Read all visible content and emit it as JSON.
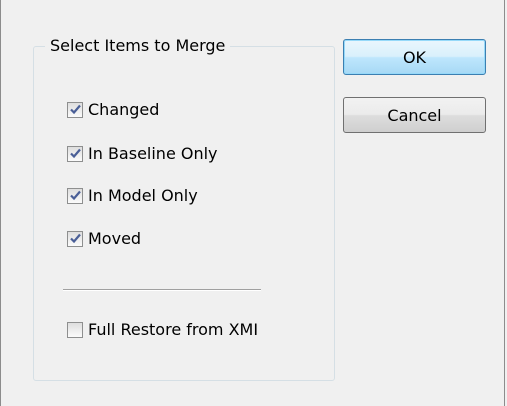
{
  "dialog": {
    "group_title": "Select Items to Merge",
    "options": [
      {
        "label": "Changed",
        "checked": true
      },
      {
        "label": "In Baseline Only",
        "checked": true
      },
      {
        "label": "In Model Only",
        "checked": true
      },
      {
        "label": "Moved",
        "checked": true
      }
    ],
    "full_restore": {
      "label": "Full Restore from XMI",
      "checked": false
    },
    "buttons": {
      "ok_label": "OK",
      "cancel_label": "Cancel"
    }
  },
  "colors": {
    "dialog_background": "#f0f0f0",
    "checkmark": "#4a5f97",
    "default_button_border": "#3c7fb1"
  }
}
